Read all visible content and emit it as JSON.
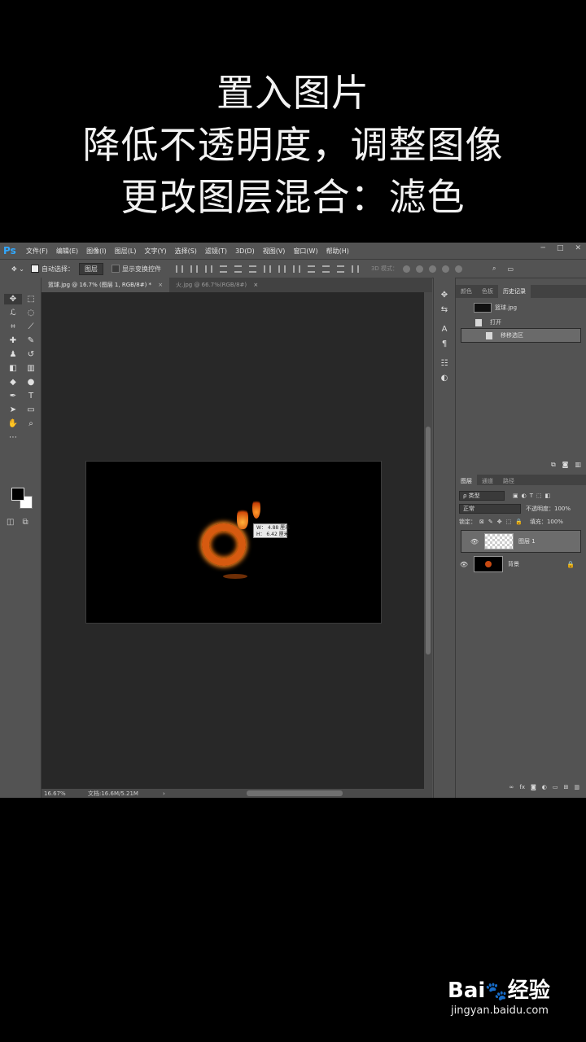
{
  "caption": {
    "line1": "置入图片",
    "line2": "降低不透明度，调整图像",
    "line3": "更改图层混合：滤色"
  },
  "app": {
    "logo": "Ps",
    "menu": [
      "文件(F)",
      "编辑(E)",
      "图像(I)",
      "图层(L)",
      "文字(Y)",
      "选择(S)",
      "滤镜(T)",
      "3D(D)",
      "视图(V)",
      "窗口(W)",
      "帮助(H)"
    ],
    "window_controls": [
      "─",
      "□",
      "✕"
    ]
  },
  "options_bar": {
    "auto_select_label": "自动选择：",
    "auto_select_value": "图层",
    "show_transform_label": "显示变换控件",
    "mode_3d_label": "3D 模式："
  },
  "documents": {
    "tabs": [
      {
        "label": "篮球.jpg @ 16.7% (图层 1, RGB/8#) *",
        "active": true
      },
      {
        "label": "火.jpg @ 66.7%(RGB/8#)",
        "active": false
      }
    ],
    "close_glyph": "×"
  },
  "canvas": {
    "tooltip_w": "W：  4.88 厘米",
    "tooltip_h": "H：  6.42 厘米"
  },
  "status_bar": {
    "zoom": "16.67%",
    "doc_size": "文档:16.6M/5.21M",
    "arrow": "›"
  },
  "history_panel": {
    "tabs": [
      "颜色",
      "色板",
      "历史记录"
    ],
    "active_tab": "历史记录",
    "snapshot": "篮球.jpg",
    "items": [
      "打开",
      "移移选区"
    ],
    "selected_item": "移移选区"
  },
  "layers_panel": {
    "tabs": [
      "图层",
      "通道",
      "路径"
    ],
    "filter_label": "ρ 类型",
    "blend_mode": "正常",
    "opacity_label": "不透明度：",
    "opacity_value": "100%",
    "lock_label": "锁定：",
    "fill_label": "填充：",
    "fill_value": "100%",
    "layers": [
      {
        "name": "图层 1",
        "selected": true
      },
      {
        "name": "背景",
        "selected": false,
        "locked": true
      }
    ]
  },
  "watermark": {
    "brand": "Bai",
    "brand_cn": "经验",
    "url": "jingyan.baidu.com"
  }
}
